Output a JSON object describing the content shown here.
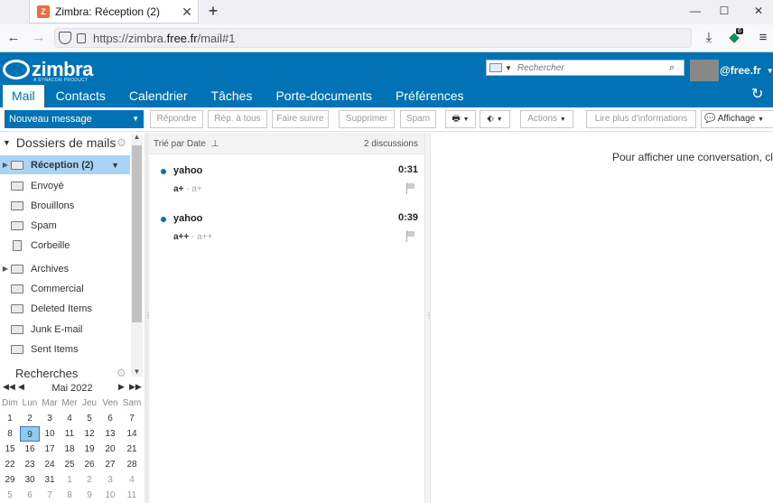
{
  "browser": {
    "tab_title": "Zimbra: Réception (2)",
    "tab_favicon_text": "Z",
    "new_tab": "+",
    "url_prefix": "https://zimbra.",
    "url_domain": "free.fr",
    "url_suffix": "/mail#1",
    "extension_badge": "6"
  },
  "header": {
    "logo_text": "zimbra",
    "logo_sub": "A SYNACOR PRODUCT",
    "search_placeholder": "Rechercher",
    "user_name": "@free.fr",
    "app_tabs": [
      "Mail",
      "Contacts",
      "Calendrier",
      "Tâches",
      "Porte-documents",
      "Préférences"
    ]
  },
  "toolbar": {
    "new_message": "Nouveau message",
    "reply": "Répondre",
    "reply_all": "Rép. à tous",
    "forward": "Faire suivre",
    "delete": "Supprimer",
    "spam": "Spam",
    "actions": "Actions",
    "more_info": "Lire plus d'informations",
    "view": "Affichage"
  },
  "sidebar": {
    "folders_header": "Dossiers de mails",
    "folders": [
      {
        "label": "Réception (2)",
        "icon": "inbox-icon",
        "selected": true
      },
      {
        "label": "Envoyé",
        "icon": "sent-icon"
      },
      {
        "label": "Brouillons",
        "icon": "drafts-icon"
      },
      {
        "label": "Spam",
        "icon": "spam-icon"
      },
      {
        "label": "Corbeille",
        "icon": "trash-icon"
      },
      {
        "label": "Archives",
        "icon": "folder-icon"
      },
      {
        "label": "Commercial",
        "icon": "folder-icon"
      },
      {
        "label": "Deleted Items",
        "icon": "folder-icon"
      },
      {
        "label": "Junk E-mail",
        "icon": "folder-icon"
      },
      {
        "label": "Sent Items",
        "icon": "folder-icon"
      }
    ],
    "searches_header": "Recherches"
  },
  "calendar": {
    "month": "Mai 2022",
    "dow": [
      "Dim",
      "Lun",
      "Mar",
      "Mer",
      "Jeu",
      "Ven",
      "Sam"
    ],
    "weeks": [
      [
        "1",
        "2",
        "3",
        "4",
        "5",
        "6",
        "7"
      ],
      [
        "8",
        "9",
        "10",
        "11",
        "12",
        "13",
        "14"
      ],
      [
        "15",
        "16",
        "17",
        "18",
        "19",
        "20",
        "21"
      ],
      [
        "22",
        "23",
        "24",
        "25",
        "26",
        "27",
        "28"
      ],
      [
        "29",
        "30",
        "31",
        "1",
        "2",
        "3",
        "4"
      ],
      [
        "5",
        "6",
        "7",
        "8",
        "9",
        "10",
        "11"
      ]
    ],
    "today": "9"
  },
  "list": {
    "sort_label": "Trié par Date",
    "count_label": "2 discussions",
    "messages": [
      {
        "from": "yahoo",
        "time": "0:31",
        "subject": "a+",
        "fragment": " - a+"
      },
      {
        "from": "yahoo",
        "time": "0:39",
        "subject": "a++",
        "fragment": " - a++"
      }
    ]
  },
  "reading_pane": {
    "message": "Pour afficher une conversation, cliquez dessus."
  }
}
